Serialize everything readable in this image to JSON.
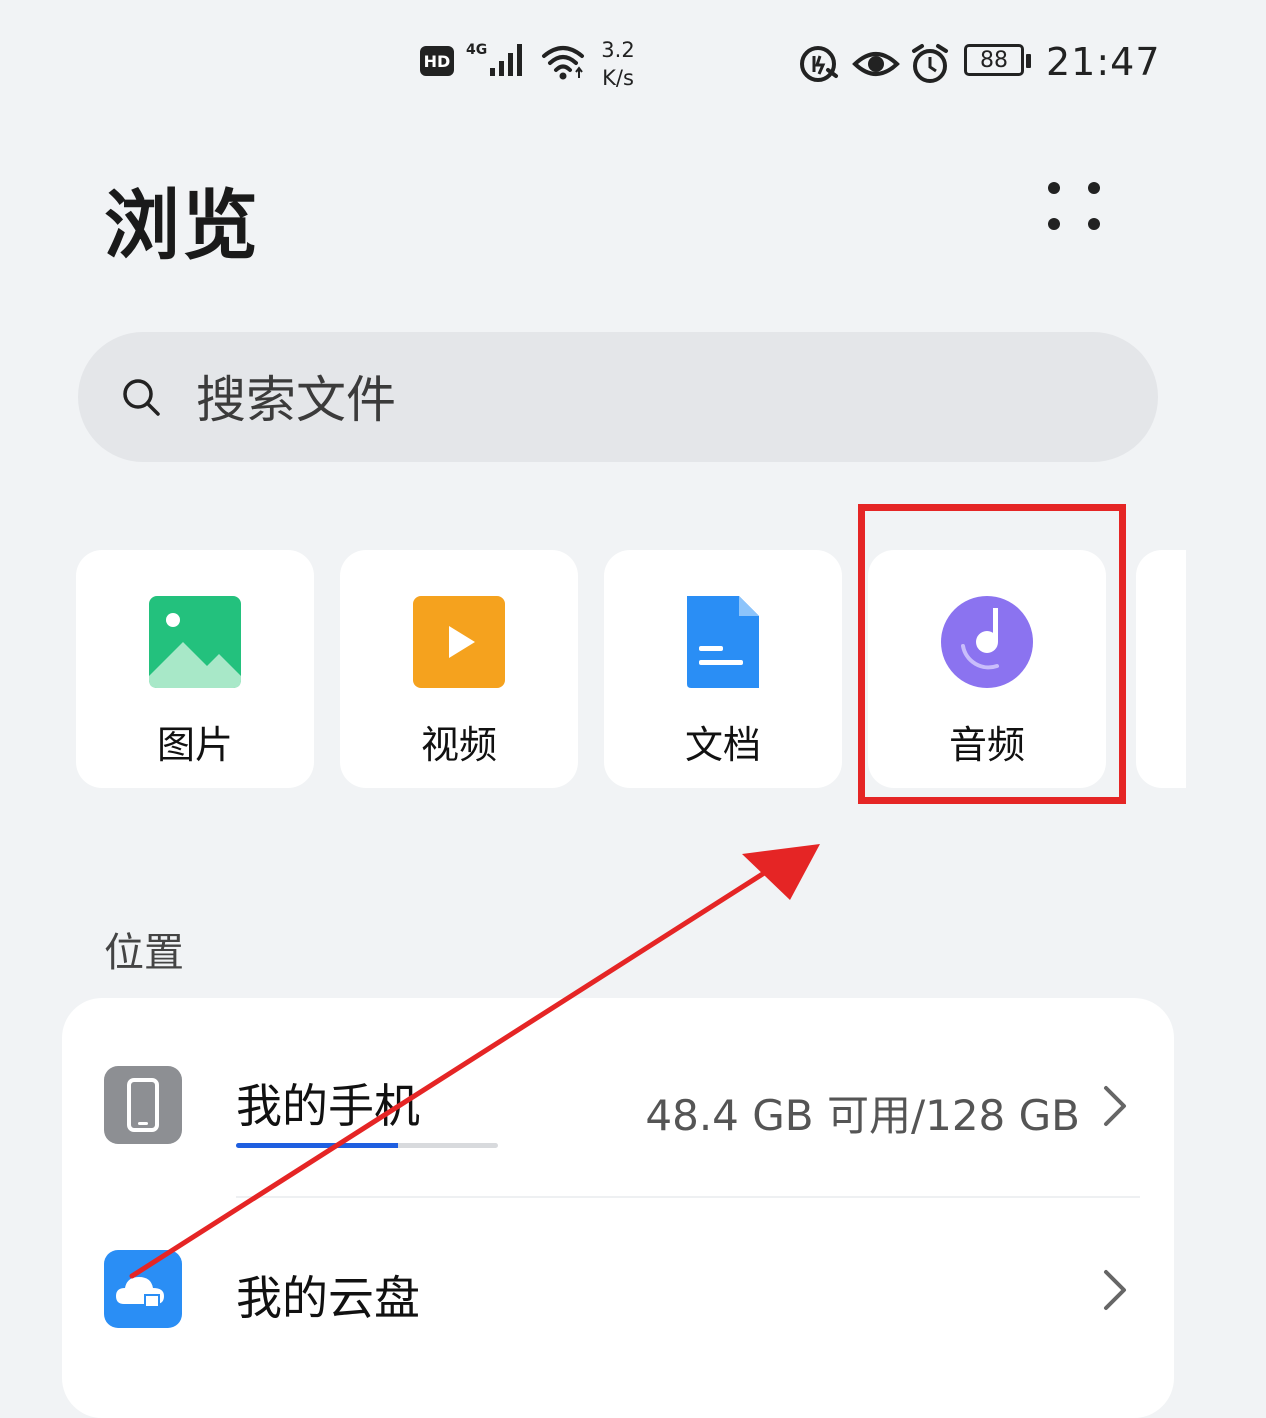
{
  "status_bar": {
    "hd": "HD",
    "network": "4G",
    "speed_value": "3.2",
    "speed_unit": "K/s",
    "battery": "88",
    "time": "21:47",
    "icons": [
      "signal-icon",
      "wifi-icon",
      "flash-icon",
      "eye-icon",
      "alarm-icon",
      "battery-icon"
    ]
  },
  "header": {
    "title": "浏览",
    "more_icon": "more-dots-icon"
  },
  "search": {
    "placeholder": "搜索文件",
    "icon": "search-icon"
  },
  "categories": [
    {
      "label": "图片",
      "icon": "image-icon",
      "color": "#23c17d"
    },
    {
      "label": "视频",
      "icon": "video-play-icon",
      "color": "#f5a21e"
    },
    {
      "label": "文档",
      "icon": "document-icon",
      "color": "#2a8ef5"
    },
    {
      "label": "音频",
      "icon": "audio-disc-icon",
      "color": "#8b73f0"
    }
  ],
  "locations": {
    "section_title": "位置",
    "items": [
      {
        "label": "我的手机",
        "icon": "phone-icon",
        "detail": "48.4 GB 可用/128 GB",
        "storage_used_fraction": 0.62
      },
      {
        "label": "我的云盘",
        "icon": "cloud-icon",
        "detail": ""
      }
    ]
  },
  "annotation": {
    "highlight_color": "#e52525"
  }
}
